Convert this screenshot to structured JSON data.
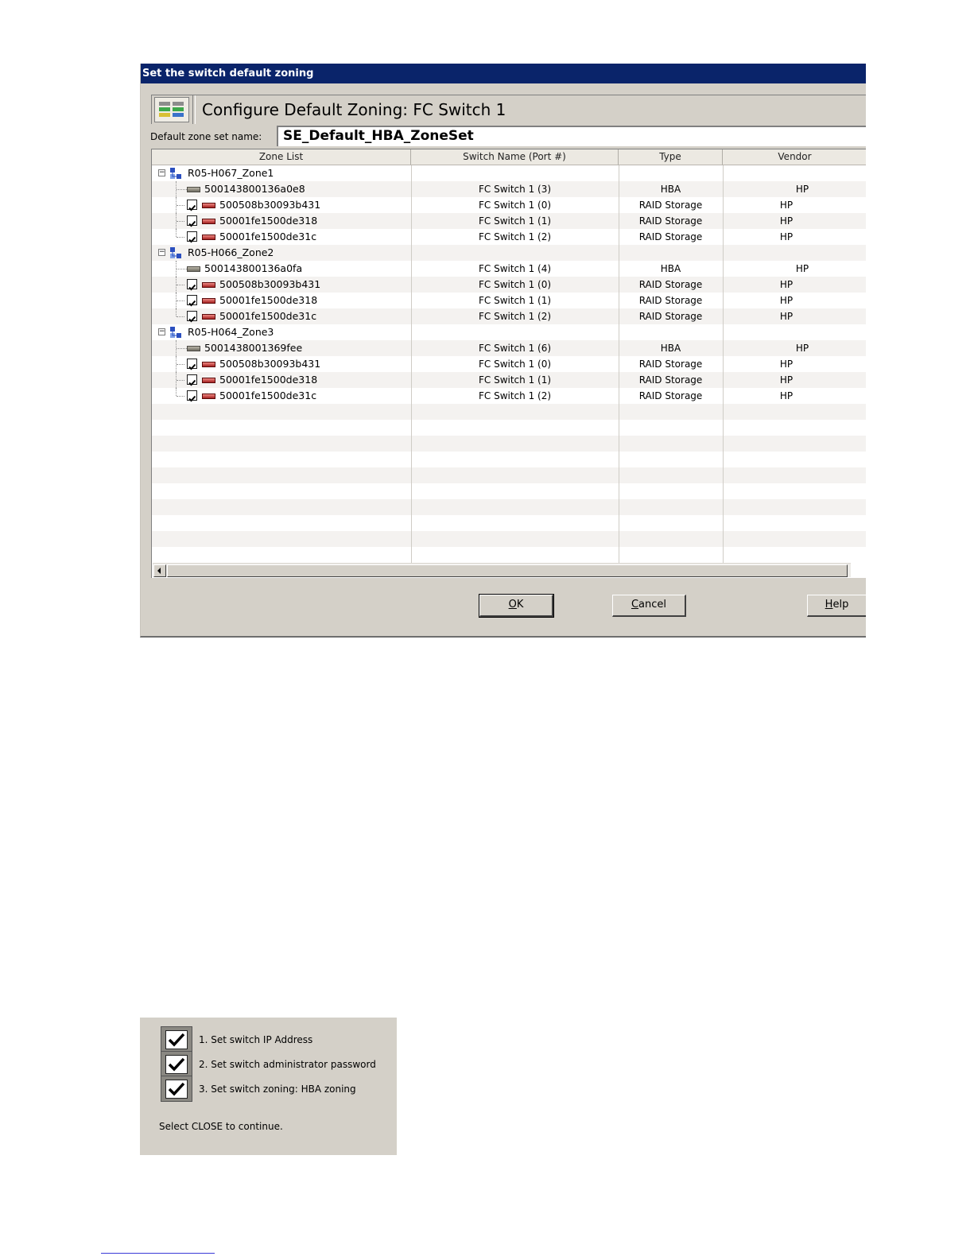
{
  "dialog": {
    "title": "Set the switch default zoning",
    "header_title": "Configure Default Zoning: FC Switch 1",
    "zone_set_label": "Default zone set name:",
    "zone_set_value": "SE_Default_HBA_ZoneSet"
  },
  "columns": [
    "Zone List",
    "Switch Name (Port #)",
    "Type",
    "Vendor"
  ],
  "zones": [
    {
      "name": "R05-H067_Zone1",
      "members": [
        {
          "wwn": "500143800136a0e8",
          "kind": "hba",
          "checkbox": false,
          "switch": "FC Switch 1 (3)",
          "type": "HBA",
          "vendor": "HP"
        },
        {
          "wwn": "500508b30093b431",
          "kind": "raid",
          "checkbox": true,
          "switch": "FC Switch 1 (0)",
          "type": "RAID Storage",
          "vendor": "HP"
        },
        {
          "wwn": "50001fe1500de318",
          "kind": "raid",
          "checkbox": true,
          "switch": "FC Switch 1 (1)",
          "type": "RAID Storage",
          "vendor": "HP"
        },
        {
          "wwn": "50001fe1500de31c",
          "kind": "raid",
          "checkbox": true,
          "switch": "FC Switch 1 (2)",
          "type": "RAID Storage",
          "vendor": "HP"
        }
      ]
    },
    {
      "name": "R05-H066_Zone2",
      "members": [
        {
          "wwn": "500143800136a0fa",
          "kind": "hba",
          "checkbox": false,
          "switch": "FC Switch 1 (4)",
          "type": "HBA",
          "vendor": "HP"
        },
        {
          "wwn": "500508b30093b431",
          "kind": "raid",
          "checkbox": true,
          "switch": "FC Switch 1 (0)",
          "type": "RAID Storage",
          "vendor": "HP"
        },
        {
          "wwn": "50001fe1500de318",
          "kind": "raid",
          "checkbox": true,
          "switch": "FC Switch 1 (1)",
          "type": "RAID Storage",
          "vendor": "HP"
        },
        {
          "wwn": "50001fe1500de31c",
          "kind": "raid",
          "checkbox": true,
          "switch": "FC Switch 1 (2)",
          "type": "RAID Storage",
          "vendor": "HP"
        }
      ]
    },
    {
      "name": "R05-H064_Zone3",
      "members": [
        {
          "wwn": "5001438001369fee",
          "kind": "hba",
          "checkbox": false,
          "switch": "FC Switch 1 (6)",
          "type": "HBA",
          "vendor": "HP"
        },
        {
          "wwn": "500508b30093b431",
          "kind": "raid",
          "checkbox": true,
          "switch": "FC Switch 1 (0)",
          "type": "RAID Storage",
          "vendor": "HP"
        },
        {
          "wwn": "50001fe1500de318",
          "kind": "raid",
          "checkbox": true,
          "switch": "FC Switch 1 (1)",
          "type": "RAID Storage",
          "vendor": "HP"
        },
        {
          "wwn": "50001fe1500de31c",
          "kind": "raid",
          "checkbox": true,
          "switch": "FC Switch 1 (2)",
          "type": "RAID Storage",
          "vendor": "HP"
        }
      ]
    }
  ],
  "buttons": {
    "ok": {
      "mnemonic": "O",
      "rest": "K"
    },
    "cancel": {
      "mnemonic": "C",
      "rest": "ancel"
    },
    "help": {
      "mnemonic": "H",
      "rest": "elp"
    }
  },
  "summary": {
    "steps": [
      "1. Set switch IP Address",
      "2. Set switch administrator password",
      "3. Set switch zoning: HBA zoning"
    ],
    "footer": "Select CLOSE to continue."
  },
  "colors": {
    "titlebar": "#0a246a",
    "dialog_bg": "#d4d0c8",
    "raid_port": "#c0392b",
    "zone_icon": "#2b4fbf"
  }
}
